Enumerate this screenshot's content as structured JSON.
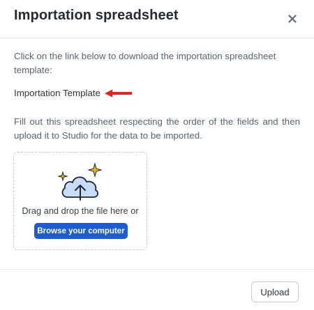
{
  "dialog": {
    "title": "Importation spreadsheet",
    "close_icon": "close-icon"
  },
  "instructions": {
    "download_text": "Click on the link below to download the importation spreadsheet template:",
    "template_link": "Importation Template",
    "fill_text": "Fill out this spreadsheet respecting the order of the fields and then upload it to Studio for the data to be imported."
  },
  "dropzone": {
    "icon": "cloud-upload-icon",
    "text": "Drag and drop the file here or",
    "browse_label": "Browse your computer"
  },
  "footer": {
    "upload_label": "Upload"
  },
  "colors": {
    "primary": "#1f5bd1",
    "arrow": "#e02424",
    "cloud_fill": "#c9dcf7",
    "sparkle": "#f2b705"
  }
}
